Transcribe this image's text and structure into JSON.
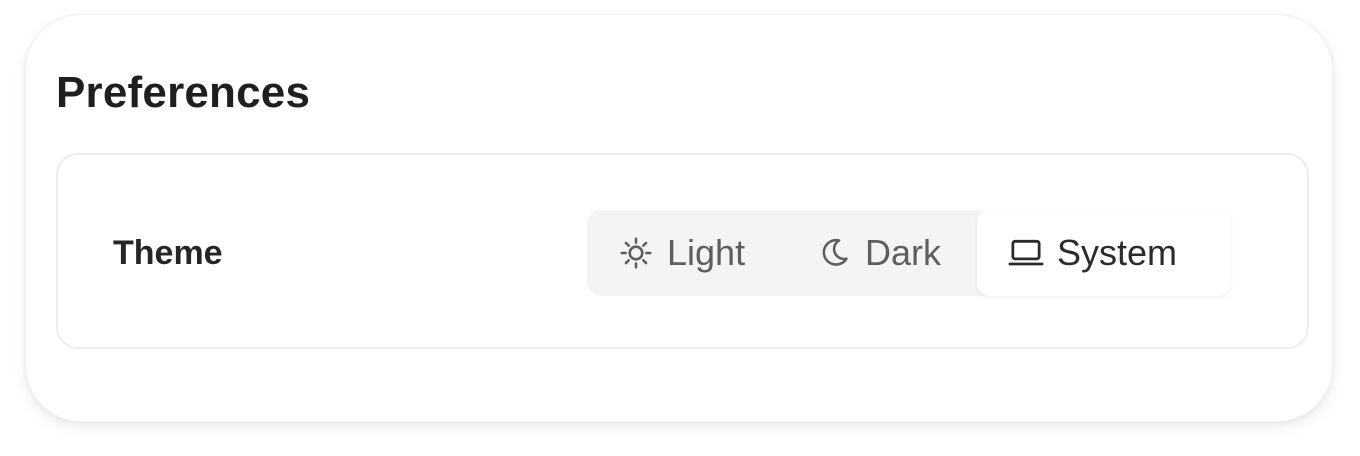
{
  "preferences": {
    "title": "Preferences",
    "theme": {
      "label": "Theme",
      "selected": "System",
      "options": [
        {
          "label": "Light",
          "icon": "sun-icon"
        },
        {
          "label": "Dark",
          "icon": "moon-icon"
        },
        {
          "label": "System",
          "icon": "laptop-icon"
        }
      ]
    }
  },
  "colors": {
    "selected_bg": "#ffffff",
    "track_bg": "#f4f4f4",
    "text_muted": "#5e5e5e",
    "text_strong": "#2b2b2b"
  }
}
